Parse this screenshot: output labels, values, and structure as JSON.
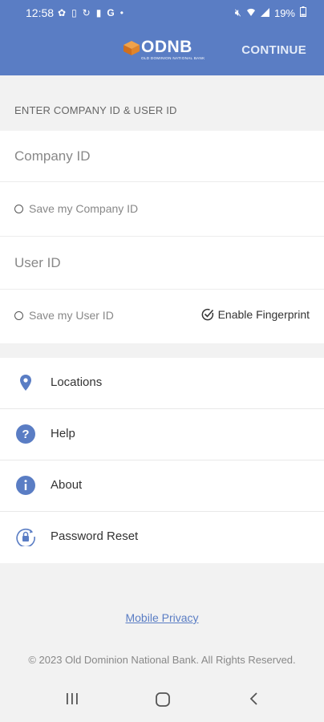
{
  "status_bar": {
    "time": "12:58",
    "left_icons": [
      "gear-icon",
      "card-icon",
      "sync-icon",
      "battery-saver-icon",
      "google-icon",
      "dot-icon"
    ],
    "battery": "19%",
    "right_icons": [
      "mute-icon",
      "wifi-icon",
      "signal-icon",
      "battery-icon"
    ]
  },
  "header": {
    "brand": "ODNB",
    "brand_subtitle": "OLD DOMINION NATIONAL BANK",
    "continue_label": "CONTINUE"
  },
  "form": {
    "section_label": "ENTER COMPANY ID & USER ID",
    "company_id_placeholder": "Company ID",
    "save_company_id_label": "Save my Company ID",
    "user_id_placeholder": "User ID",
    "save_user_id_label": "Save my User ID",
    "enable_fingerprint_label": "Enable Fingerprint"
  },
  "menu": {
    "items": [
      {
        "label": "Locations",
        "icon": "location-pin-icon"
      },
      {
        "label": "Help",
        "icon": "help-icon"
      },
      {
        "label": "About",
        "icon": "info-icon"
      },
      {
        "label": "Password Reset",
        "icon": "lock-reset-icon"
      }
    ]
  },
  "footer": {
    "privacy_link": "Mobile Privacy",
    "copyright": "© 2023 Old Dominion National Bank. All Rights Reserved."
  },
  "nav_bar": [
    "recent-apps-icon",
    "home-icon",
    "back-icon"
  ],
  "colors": {
    "primary": "#5a7dc4",
    "logo_accent": "#e0852b"
  }
}
